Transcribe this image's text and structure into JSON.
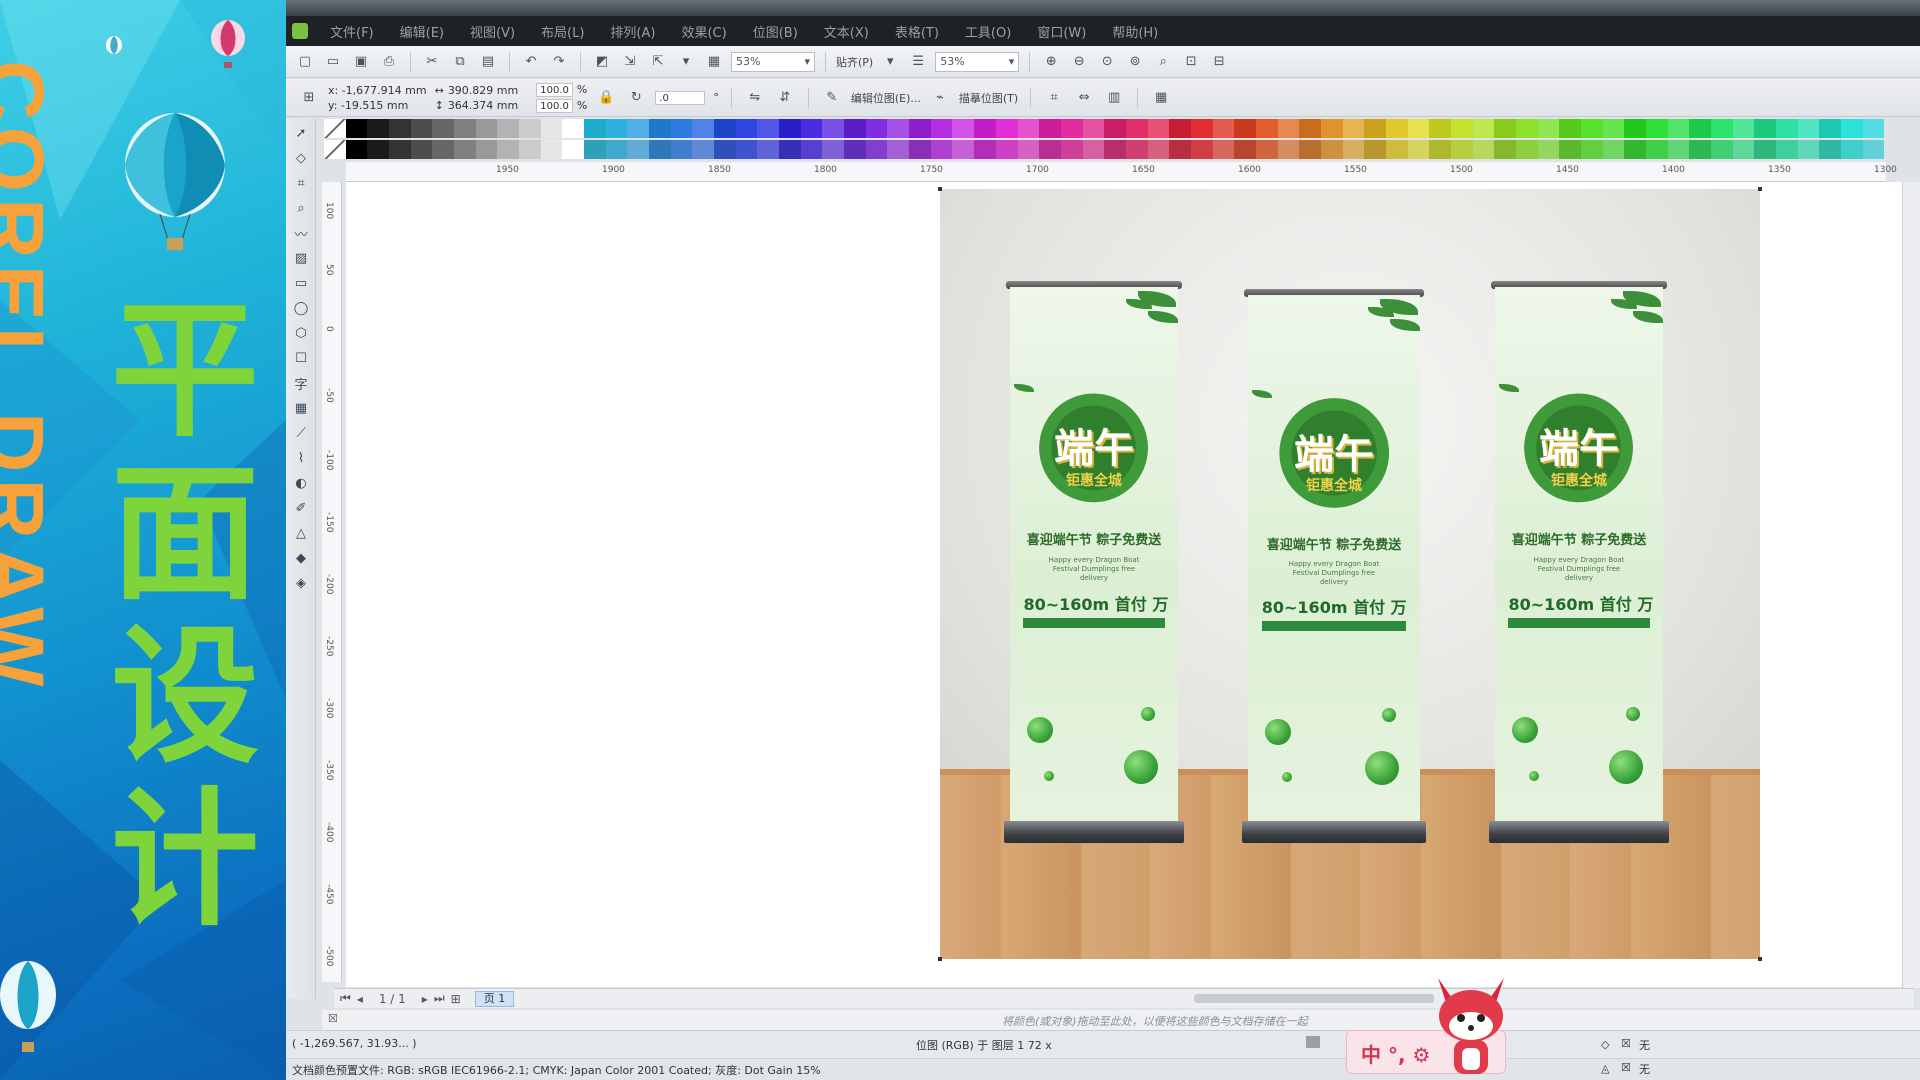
{
  "promo": {
    "vertical_text": "COREL DRAW",
    "title": "平面设计",
    "colors": {
      "title": "#7ed43a",
      "vertical": "#f6a13a",
      "bg": "#1190cf"
    }
  },
  "menubar": {
    "items": [
      "文件(F)",
      "编辑(E)",
      "视图(V)",
      "布局(L)",
      "排列(A)",
      "效果(C)",
      "位图(B)",
      "文本(X)",
      "表格(T)",
      "工具(O)",
      "窗口(W)",
      "帮助(H)"
    ]
  },
  "toolbar1": {
    "zoom_left": "53%",
    "snap_label": "贴齐(P)",
    "zoom_right": "53%"
  },
  "toolbar2": {
    "x": "x: -1,677.914 mm",
    "y": "y: -19.515 mm",
    "width": "390.829 mm",
    "height": "364.374 mm",
    "scale_w": "100.0",
    "scale_h": "100.0",
    "percent": "%",
    "rotation": ".0",
    "edit_bitmap": "编辑位图(E)...",
    "trace_bitmap": "描摹位图(T)"
  },
  "ruler_top": [
    "1950",
    "1900",
    "1850",
    "1800",
    "1750",
    "1700",
    "1650",
    "1600",
    "1550",
    "1500",
    "1450",
    "1400",
    "1350",
    "1300"
  ],
  "ruler_left": [
    "100",
    "50",
    "0",
    "-50",
    "-100",
    "-150",
    "-200",
    "-250",
    "-300",
    "-350",
    "-400",
    "-450",
    "-500"
  ],
  "standee": {
    "headline": "端午",
    "subheadline": "钜惠全城",
    "tagline": "喜迎端午节 粽子免费送",
    "tagline_en": "Happy every Dragon Boat Festival Dumplings free delivery",
    "price": "80~160m 首付",
    "price_suffix": "万"
  },
  "pager": {
    "page_count": "1 / 1",
    "page_tab": "页 1"
  },
  "hint_text": "将颜色(或对象)拖动至此处，以便将这些颜色与文档存储在一起",
  "status": {
    "coords": "( -1,269.567, 31.93... )",
    "object_info": "位图 (RGB) 于 图层 1 72 x",
    "fill_label": "无",
    "outline_label": "无",
    "color_profile": "文档颜色预置文件: RGB: sRGB IEC61966-2.1; CMYK: Japan Color 2001 Coated; 灰度: Dot Gain 15%"
  },
  "ime": {
    "label": "中 °, ⚙"
  },
  "colors": {
    "menubar_bg": "#1e2126",
    "accent_green": "#7bc043"
  }
}
